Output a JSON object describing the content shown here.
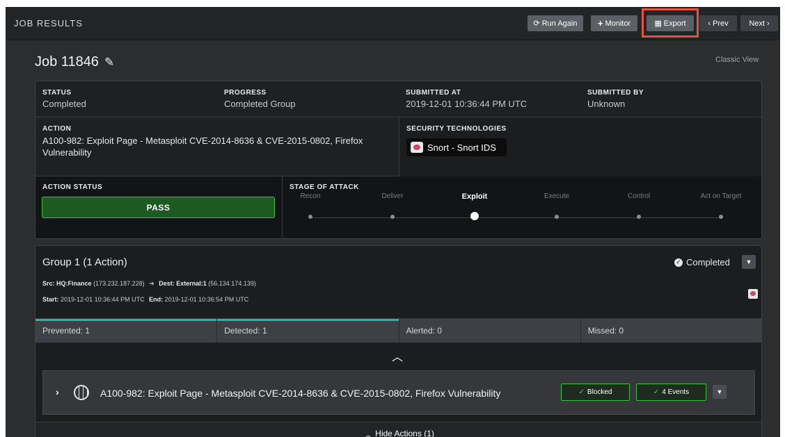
{
  "header": {
    "title": "JOB RESULTS",
    "buttons": {
      "run_again": "Run Again",
      "monitor": "Monitor",
      "export": "Export",
      "prev": "Prev",
      "next": "Next"
    }
  },
  "job": {
    "title": "Job 11846",
    "classic_view": "Classic View"
  },
  "details": {
    "status_label": "STATUS",
    "status_value": "Completed",
    "progress_label": "PROGRESS",
    "progress_value": "Completed Group",
    "submitted_at_label": "SUBMITTED AT",
    "submitted_at_value": "2019-12-01 10:36:44 PM UTC",
    "submitted_by_label": "SUBMITTED BY",
    "submitted_by_value": "Unknown",
    "action_label": "ACTION",
    "action_value": "A100-982: Exploit Page - Metasploit CVE-2014-8636 & CVE-2015-0802, Firefox Vulnerability",
    "security_tech_label": "SECURITY TECHNOLOGIES",
    "security_tech_value": "Snort - Snort IDS",
    "action_status_label": "ACTION STATUS",
    "action_status_value": "PASS",
    "stage_label": "STAGE OF ATTACK",
    "stages": [
      "Recon",
      "Deliver",
      "Exploit",
      "Execute",
      "Control",
      "Act on Target"
    ],
    "active_stage": "Exploit"
  },
  "group": {
    "title": "Group 1 (1 Action)",
    "status": "Completed",
    "src_label": "Src:",
    "src_name": "HQ:Finance",
    "src_ip": "(173.232.187.228)",
    "dest_label": "Dest:",
    "dest_name": "External:1",
    "dest_ip": "(56.134.174.139)",
    "start_label": "Start:",
    "start_value": "2019-12-01 10:36:44 PM UTC",
    "end_label": "End:",
    "end_value": "2019-12-01 10:36:54 PM UTC",
    "tabs": [
      "Prevented: 1",
      "Detected: 1",
      "Alerted: 0",
      "Missed: 0"
    ],
    "action_row": {
      "name": "A100-982: Exploit Page - Metasploit CVE-2014-8636 & CVE-2015-0802, Firefox Vulnerability",
      "blocked": "Blocked",
      "events": "4 Events"
    },
    "hide_actions": "Hide Actions (1)"
  },
  "colors": {
    "accent_teal": "#2ab3a6",
    "pass_green": "#3fbf4a",
    "highlight_red": "#e5533f"
  },
  "icons": [
    "refresh-icon",
    "plus-icon",
    "table-icon",
    "chevron-left-icon",
    "chevron-right-icon",
    "pencil-icon",
    "snort-pig-icon",
    "check-circle-icon",
    "caret-down-icon",
    "arrow-right-icon",
    "chevron-up-icon",
    "globe-icon",
    "check-icon"
  ]
}
